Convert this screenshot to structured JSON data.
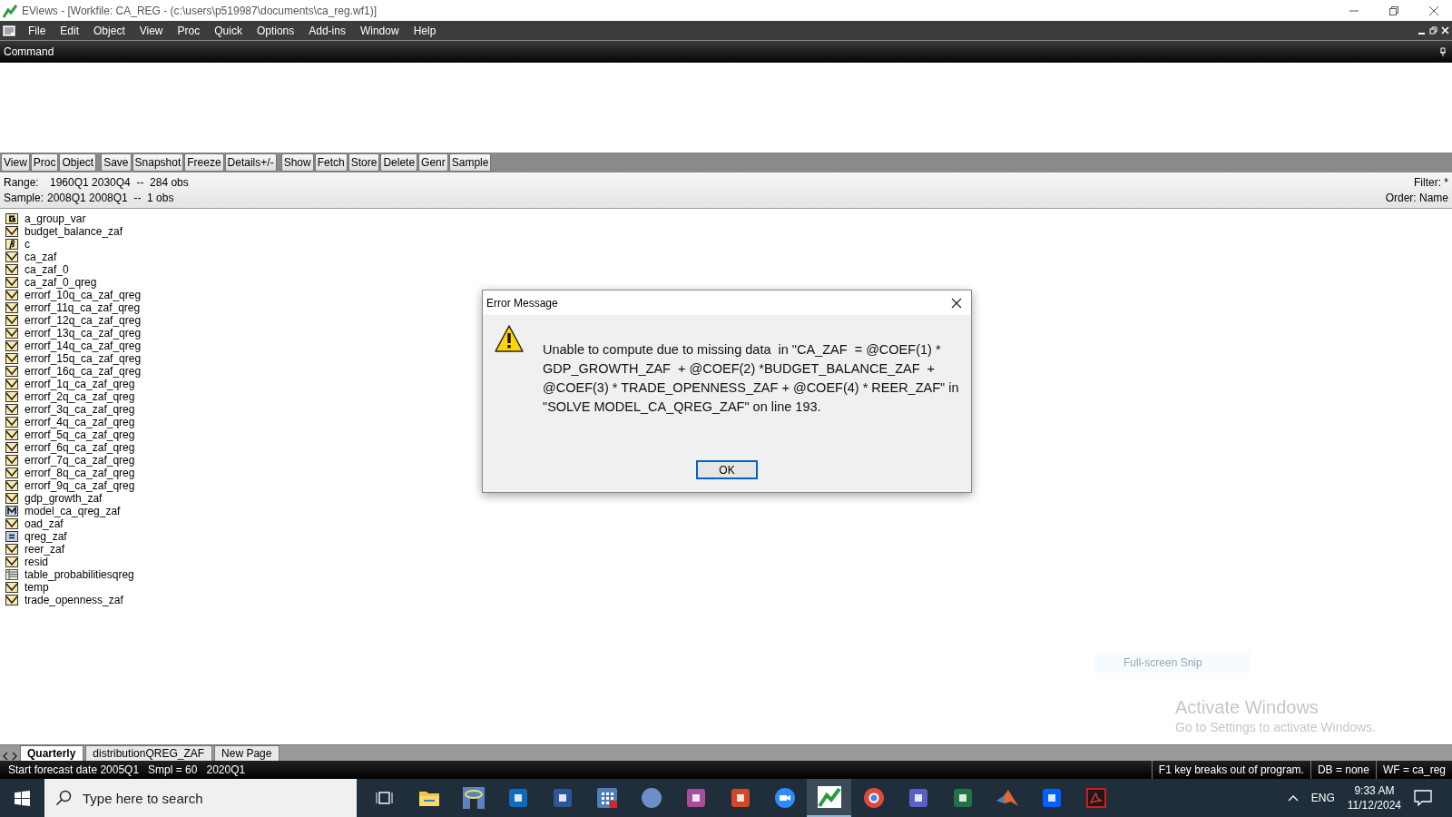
{
  "window": {
    "title": "EViews - [Workfile: CA_REG - (c:\\users\\p519987\\documents\\ca_reg.wf1)]"
  },
  "menu": [
    "File",
    "Edit",
    "Object",
    "View",
    "Proc",
    "Quick",
    "Options",
    "Add-ins",
    "Window",
    "Help"
  ],
  "command_pane": {
    "title": "Command"
  },
  "toolbar": {
    "groups": [
      [
        "View",
        "Proc",
        "Object"
      ],
      [
        "Save",
        "Snapshot",
        "Freeze",
        "Details+/-"
      ],
      [
        "Show",
        "Fetch",
        "Store",
        "Delete",
        "Genr",
        "Sample"
      ]
    ]
  },
  "info": {
    "range_label": "Range:",
    "range": "1960Q1 2030Q4  --  284 obs",
    "sample_label": "Sample:",
    "sample": "2008Q1 2008Q1  --  1 obs",
    "filter": "Filter: *",
    "order": "Order: Name"
  },
  "objects": [
    {
      "name": "a_group_var",
      "kind": "group"
    },
    {
      "name": "budget_balance_zaf",
      "kind": "series"
    },
    {
      "name": "c",
      "kind": "coef"
    },
    {
      "name": "ca_zaf",
      "kind": "series"
    },
    {
      "name": "ca_zaf_0",
      "kind": "series"
    },
    {
      "name": "ca_zaf_0_qreg",
      "kind": "series"
    },
    {
      "name": "errorf_10q_ca_zaf_qreg",
      "kind": "series"
    },
    {
      "name": "errorf_11q_ca_zaf_qreg",
      "kind": "series"
    },
    {
      "name": "errorf_12q_ca_zaf_qreg",
      "kind": "series"
    },
    {
      "name": "errorf_13q_ca_zaf_qreg",
      "kind": "series"
    },
    {
      "name": "errorf_14q_ca_zaf_qreg",
      "kind": "series"
    },
    {
      "name": "errorf_15q_ca_zaf_qreg",
      "kind": "series"
    },
    {
      "name": "errorf_16q_ca_zaf_qreg",
      "kind": "series"
    },
    {
      "name": "errorf_1q_ca_zaf_qreg",
      "kind": "series"
    },
    {
      "name": "errorf_2q_ca_zaf_qreg",
      "kind": "series"
    },
    {
      "name": "errorf_3q_ca_zaf_qreg",
      "kind": "series"
    },
    {
      "name": "errorf_4q_ca_zaf_qreg",
      "kind": "series"
    },
    {
      "name": "errorf_5q_ca_zaf_qreg",
      "kind": "series"
    },
    {
      "name": "errorf_6q_ca_zaf_qreg",
      "kind": "series"
    },
    {
      "name": "errorf_7q_ca_zaf_qreg",
      "kind": "series"
    },
    {
      "name": "errorf_8q_ca_zaf_qreg",
      "kind": "series"
    },
    {
      "name": "errorf_9q_ca_zaf_qreg",
      "kind": "series"
    },
    {
      "name": "gdp_growth_zaf",
      "kind": "series"
    },
    {
      "name": "model_ca_qreg_zaf",
      "kind": "model"
    },
    {
      "name": "oad_zaf",
      "kind": "series"
    },
    {
      "name": "qreg_zaf",
      "kind": "equation"
    },
    {
      "name": "reer_zaf",
      "kind": "series"
    },
    {
      "name": "resid",
      "kind": "series"
    },
    {
      "name": "table_probabilitiesqreg",
      "kind": "table"
    },
    {
      "name": "temp",
      "kind": "series"
    },
    {
      "name": "trade_openness_zaf",
      "kind": "series"
    }
  ],
  "dialog": {
    "title": "Error Message",
    "message": "Unable to compute due to missing data  in \"CA_ZAF  = @COEF(1) * GDP_GROWTH_ZAF  + @COEF(2) *BUDGET_BALANCE_ZAF  + @COEF(3) * TRADE_OPENNESS_ZAF + @COEF(4) * REER_ZAF\" in \"SOLVE MODEL_CA_QREG_ZAF\" on line 193.",
    "button": "OK"
  },
  "snip_hint": "Full-screen Snip",
  "activation": {
    "title": "Activate Windows",
    "text": "Go to Settings to activate Windows."
  },
  "page_tabs": [
    {
      "label": "Quarterly",
      "selected": true
    },
    {
      "label": "distributionQREG_ZAF",
      "selected": false
    },
    {
      "label": "New Page",
      "selected": false
    }
  ],
  "status_bar": {
    "message": "Start forecast date 2005Q1   Smpl = 60   2020Q1",
    "panes": [
      "F1 key breaks out of program.",
      "DB = none",
      "WF = ca_reg"
    ]
  },
  "taskbar": {
    "search_placeholder": "Type here to search",
    "apps": [
      {
        "kind": "taskview",
        "selected": false
      },
      {
        "kind": "folder",
        "selected": false
      },
      {
        "kind": "photo",
        "selected": false
      },
      {
        "kind": "outlook",
        "selected": false
      },
      {
        "kind": "word",
        "selected": false
      },
      {
        "kind": "grid",
        "selected": false
      },
      {
        "kind": "r",
        "selected": false
      },
      {
        "kind": "m",
        "selected": false
      },
      {
        "kind": "powerpoint",
        "selected": false
      },
      {
        "kind": "zoom",
        "selected": false
      },
      {
        "kind": "eviews",
        "selected": true
      },
      {
        "kind": "chrome",
        "selected": false
      },
      {
        "kind": "teams",
        "selected": false
      },
      {
        "kind": "excel",
        "selected": false
      },
      {
        "kind": "matlab",
        "selected": false
      },
      {
        "kind": "dropbox",
        "selected": false
      },
      {
        "kind": "acrobat",
        "selected": false
      }
    ],
    "language": "ENG",
    "time": "9:33 AM",
    "date": "11/12/2024"
  }
}
